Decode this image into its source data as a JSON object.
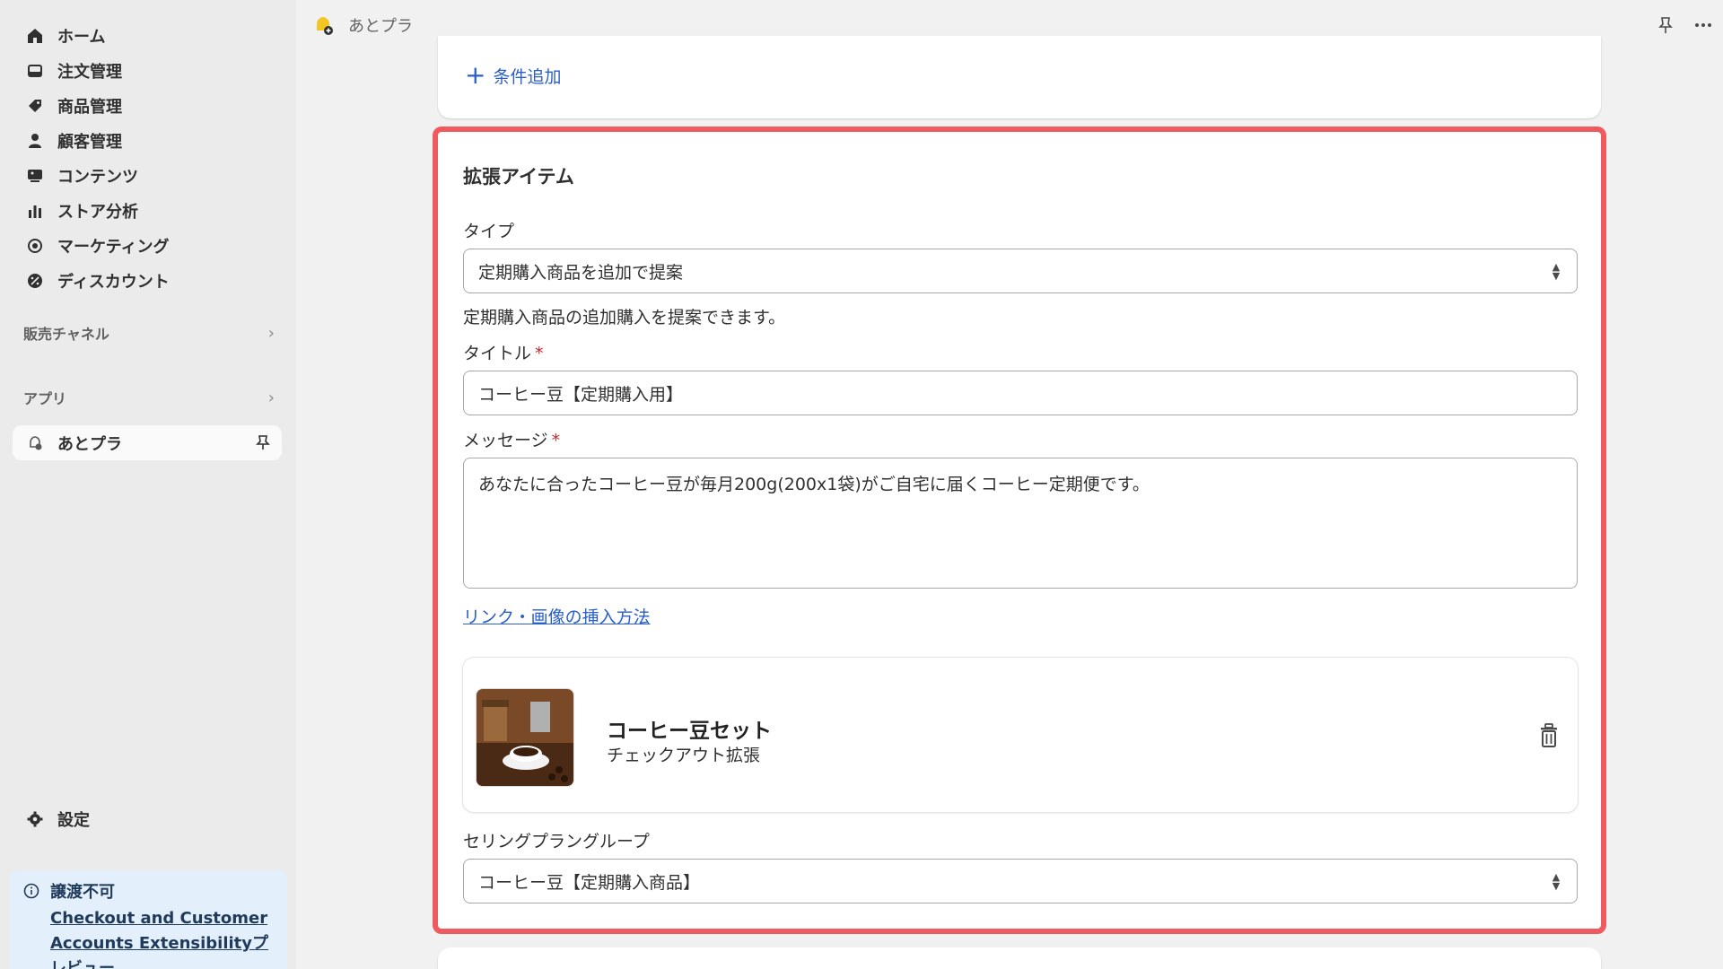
{
  "sidebar": {
    "nav": [
      {
        "label": "ホーム",
        "icon": "home-icon"
      },
      {
        "label": "注文管理",
        "icon": "inbox-icon"
      },
      {
        "label": "商品管理",
        "icon": "tag-icon"
      },
      {
        "label": "顧客管理",
        "icon": "person-icon"
      },
      {
        "label": "コンテンツ",
        "icon": "content-icon"
      },
      {
        "label": "ストア分析",
        "icon": "bar-chart-icon"
      },
      {
        "label": "マーケティング",
        "icon": "target-icon"
      },
      {
        "label": "ディスカウント",
        "icon": "discount-icon"
      }
    ],
    "sales_channels": "販売チャネル",
    "apps": "アプリ",
    "app_item": "あとプラ",
    "settings": "設定",
    "notice": {
      "title": "譲渡不可",
      "link": "Checkout and Customer Accounts Extensibilityプレビュー"
    }
  },
  "topbar": {
    "app_name": "あとプラ"
  },
  "top_card": {
    "add_condition": "条件追加"
  },
  "main_card": {
    "heading": "拡張アイテム",
    "type_label": "タイプ",
    "type_value": "定期購入商品を追加で提案",
    "type_help": "定期購入商品の追加購入を提案できます。",
    "title_label": "タイトル",
    "title_value": "コーヒー豆【定期購入用】",
    "message_label": "メッセージ",
    "message_value": "あなたに合ったコーヒー豆が毎月200g(200x1袋)がご自宅に届くコーヒー定期便です。",
    "help_link": "リンク・画像の挿入方法",
    "product": {
      "title": "コーヒー豆セット",
      "subtitle": "チェックアウト拡張"
    },
    "selling_plan_label": "セリングプラングループ",
    "selling_plan_value": "コーヒー豆【定期購入商品】"
  },
  "colors": {
    "accent": "#2a5ec9",
    "highlight_border": "#ef5a5e",
    "required": "#c0292b"
  }
}
